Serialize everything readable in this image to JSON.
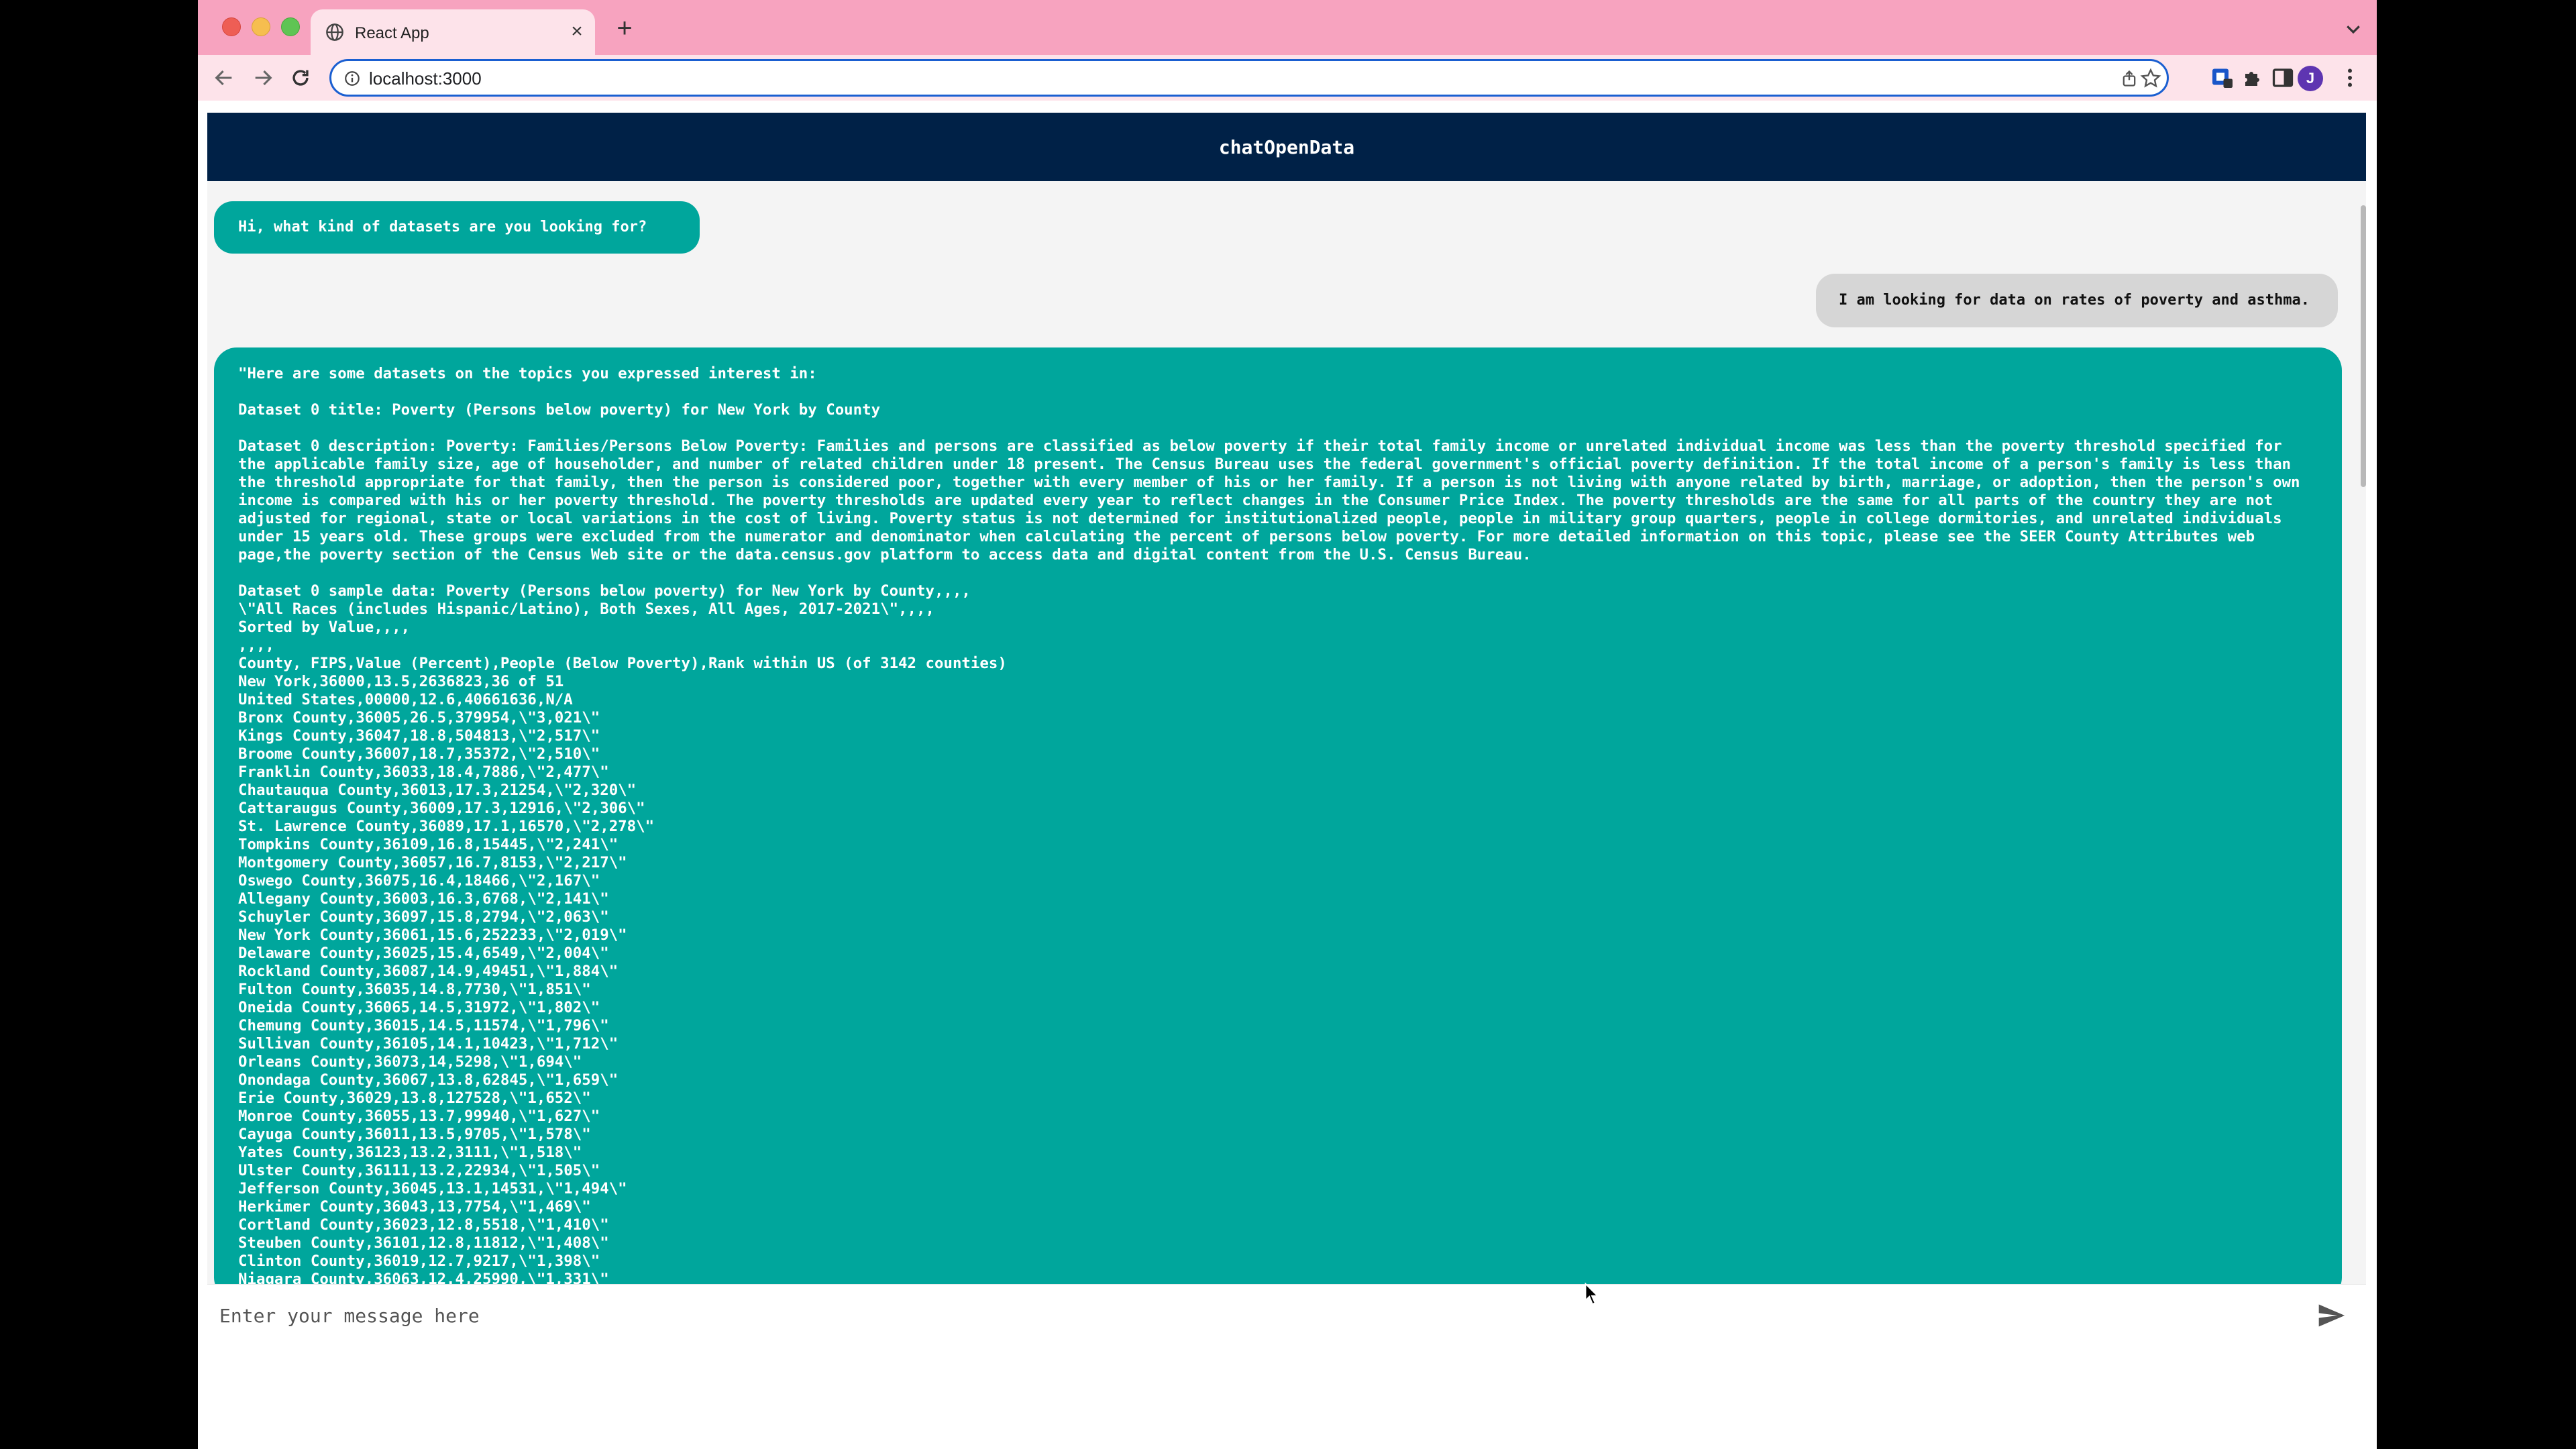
{
  "browser": {
    "tab_title": "React App",
    "tab_close": "×",
    "new_tab": "+",
    "url": "localhost:3000",
    "avatar_letter": "J"
  },
  "app": {
    "title": "chatOpenData",
    "greeting": "Hi, what kind of datasets are you looking for?",
    "user_message": "I am looking for data on rates of poverty and asthma.",
    "answer": {
      "intro": "\"Here are some datasets on the topics you expressed interest in:",
      "dataset_title": "Dataset 0 title: Poverty (Persons below poverty) for New York by County",
      "dataset_description": "Dataset 0 description: Poverty: Families/Persons Below Poverty: Families and persons are classified as below poverty if their total family income or unrelated individual income was less than the poverty threshold specified for the applicable family size, age of householder, and number of related children under 18 present. The Census Bureau uses the federal government's official poverty definition. If the total income of a person's family is less than the threshold appropriate for that family, then the person is considered poor, together with every member of his or her family. If a person is not living with anyone related by birth, marriage, or adoption, then the person's own income is compared with his or her poverty threshold. The poverty thresholds are updated every year to reflect changes in the Consumer Price Index. The poverty thresholds are the same for all parts of the country they are not adjusted for regional, state or local variations in the cost of living. Poverty status is not determined for institutionalized people, people in military group quarters, people in college dormitories, and unrelated individuals under 15 years old. These groups were excluded from the numerator and denominator when calculating the percent of persons below poverty. For more detailed information on this topic, please see the SEER County Attributes web page,the poverty section of the Census Web site or the data.census.gov platform to access data and digital content from the U.S. Census Bureau.",
      "sample_lines": [
        "Dataset 0 sample data: Poverty (Persons below poverty) for New York by County,,,,",
        "\\\"All Races (includes Hispanic/Latino), Both Sexes, All Ages, 2017-2021\\\",,,,",
        "Sorted by Value,,,,",
        ",,,,",
        "County, FIPS,Value (Percent),People (Below Poverty),Rank within US (of 3142 counties)",
        "New York,36000,13.5,2636823,36 of 51",
        "United States,00000,12.6,40661636,N/A",
        "Bronx County,36005,26.5,379954,\\\"3,021\\\"",
        "Kings County,36047,18.8,504813,\\\"2,517\\\"",
        "Broome County,36007,18.7,35372,\\\"2,510\\\"",
        "Franklin County,36033,18.4,7886,\\\"2,477\\\"",
        "Chautauqua County,36013,17.3,21254,\\\"2,320\\\"",
        "Cattaraugus County,36009,17.3,12916,\\\"2,306\\\"",
        "St. Lawrence County,36089,17.1,16570,\\\"2,278\\\"",
        "Tompkins County,36109,16.8,15445,\\\"2,241\\\"",
        "Montgomery County,36057,16.7,8153,\\\"2,217\\\"",
        "Oswego County,36075,16.4,18466,\\\"2,167\\\"",
        "Allegany County,36003,16.3,6768,\\\"2,141\\\"",
        "Schuyler County,36097,15.8,2794,\\\"2,063\\\"",
        "New York County,36061,15.6,252233,\\\"2,019\\\"",
        "Delaware County,36025,15.4,6549,\\\"2,004\\\"",
        "Rockland County,36087,14.9,49451,\\\"1,884\\\"",
        "Fulton County,36035,14.8,7730,\\\"1,851\\\"",
        "Oneida County,36065,14.5,31972,\\\"1,802\\\"",
        "Chemung County,36015,14.5,11574,\\\"1,796\\\"",
        "Sullivan County,36105,14.1,10423,\\\"1,712\\\"",
        "Orleans County,36073,14,5298,\\\"1,694\\\"",
        "Onondaga County,36067,13.8,62845,\\\"1,659\\\"",
        "Erie County,36029,13.8,127528,\\\"1,652\\\"",
        "Monroe County,36055,13.7,99940,\\\"1,627\\\"",
        "Cayuga County,36011,13.5,9705,\\\"1,578\\\"",
        "Yates County,36123,13.2,3111,\\\"1,518\\\"",
        "Ulster County,36111,13.2,22934,\\\"1,505\\\"",
        "Jefferson County,36045,13.1,14531,\\\"1,494\\\"",
        "Herkimer County,36043,13,7754,\\\"1,469\\\"",
        "Cortland County,36023,12.8,5518,\\\"1,410\\\"",
        "Steuben County,36101,12.8,11812,\\\"1,408\\\"",
        "Clinton County,36019,12.7,9217,\\\"1,398\\\"",
        "Niagara County,36063,12.4,25990,\\\"1,331\\\""
      ]
    },
    "input_placeholder": "Enter your message here"
  },
  "colors": {
    "header_bg": "#002147",
    "bot_bubble": "#00a69c",
    "user_bubble": "#d6d6d6",
    "tab_strip": "#f7a3bf"
  }
}
